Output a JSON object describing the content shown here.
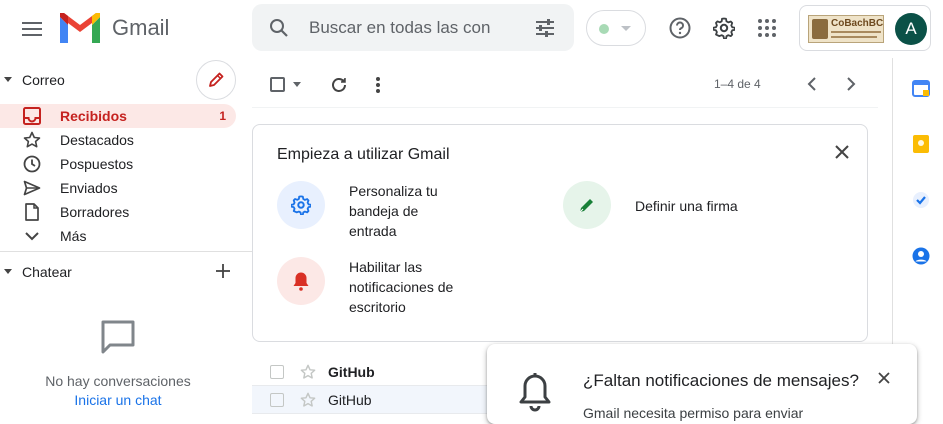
{
  "header": {
    "brand": "Gmail",
    "search_placeholder": "Buscar en todas las con",
    "avatar_initial": "A",
    "org_logo_text": "CoBachBC"
  },
  "sidebar": {
    "mail_section": "Correo",
    "items": [
      {
        "label": "Recibidos",
        "count": "1",
        "icon": "inbox-icon"
      },
      {
        "label": "Destacados",
        "icon": "star-icon"
      },
      {
        "label": "Pospuestos",
        "icon": "clock-icon"
      },
      {
        "label": "Enviados",
        "icon": "send-icon"
      },
      {
        "label": "Borradores",
        "icon": "draft-icon"
      },
      {
        "label": "Más",
        "icon": "chevron-down-icon"
      }
    ],
    "chat_section": "Chatear",
    "no_conversations": "No hay conversaciones",
    "start_chat": "Iniciar un chat"
  },
  "toolbar": {
    "pagination": "1–4 de 4"
  },
  "card": {
    "title": "Empieza a utilizar Gmail",
    "tiles": [
      {
        "line1": "Personaliza tu",
        "line2": "bandeja de",
        "line3": "entrada",
        "color": "#e8f0fe"
      },
      {
        "line1": "Definir una firma",
        "color": "#e6f4ea"
      },
      {
        "line1": "Habilitar las",
        "line2": "notificaciones de",
        "line3": "escritorio",
        "color": "#fce8e6"
      }
    ]
  },
  "emails": [
    {
      "sender": "GitHub",
      "unread": true
    },
    {
      "sender": "GitHub",
      "unread": false
    }
  ],
  "popup": {
    "title": "¿Faltan notificaciones de mensajes?",
    "body": "Gmail necesita permiso para enviar"
  },
  "colors": {
    "accent_red": "#c5221f",
    "active_bg": "#fce8e6",
    "link_blue": "#1a73e8",
    "avatar_bg": "#0b5147"
  }
}
